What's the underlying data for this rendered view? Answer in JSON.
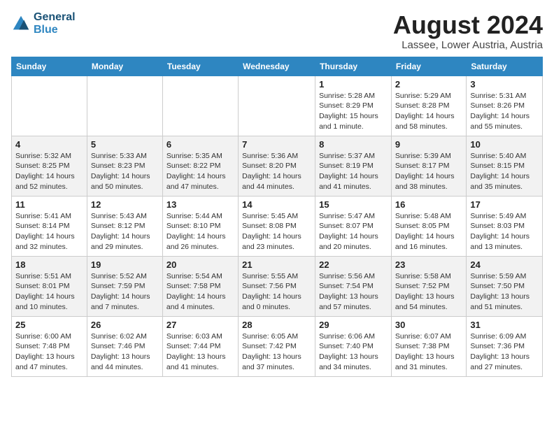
{
  "logo": {
    "line1": "General",
    "line2": "Blue"
  },
  "title": "August 2024",
  "location": "Lassee, Lower Austria, Austria",
  "days_header": [
    "Sunday",
    "Monday",
    "Tuesday",
    "Wednesday",
    "Thursday",
    "Friday",
    "Saturday"
  ],
  "weeks": [
    [
      {
        "day": "",
        "info": ""
      },
      {
        "day": "",
        "info": ""
      },
      {
        "day": "",
        "info": ""
      },
      {
        "day": "",
        "info": ""
      },
      {
        "day": "1",
        "info": "Sunrise: 5:28 AM\nSunset: 8:29 PM\nDaylight: 15 hours\nand 1 minute."
      },
      {
        "day": "2",
        "info": "Sunrise: 5:29 AM\nSunset: 8:28 PM\nDaylight: 14 hours\nand 58 minutes."
      },
      {
        "day": "3",
        "info": "Sunrise: 5:31 AM\nSunset: 8:26 PM\nDaylight: 14 hours\nand 55 minutes."
      }
    ],
    [
      {
        "day": "4",
        "info": "Sunrise: 5:32 AM\nSunset: 8:25 PM\nDaylight: 14 hours\nand 52 minutes."
      },
      {
        "day": "5",
        "info": "Sunrise: 5:33 AM\nSunset: 8:23 PM\nDaylight: 14 hours\nand 50 minutes."
      },
      {
        "day": "6",
        "info": "Sunrise: 5:35 AM\nSunset: 8:22 PM\nDaylight: 14 hours\nand 47 minutes."
      },
      {
        "day": "7",
        "info": "Sunrise: 5:36 AM\nSunset: 8:20 PM\nDaylight: 14 hours\nand 44 minutes."
      },
      {
        "day": "8",
        "info": "Sunrise: 5:37 AM\nSunset: 8:19 PM\nDaylight: 14 hours\nand 41 minutes."
      },
      {
        "day": "9",
        "info": "Sunrise: 5:39 AM\nSunset: 8:17 PM\nDaylight: 14 hours\nand 38 minutes."
      },
      {
        "day": "10",
        "info": "Sunrise: 5:40 AM\nSunset: 8:15 PM\nDaylight: 14 hours\nand 35 minutes."
      }
    ],
    [
      {
        "day": "11",
        "info": "Sunrise: 5:41 AM\nSunset: 8:14 PM\nDaylight: 14 hours\nand 32 minutes."
      },
      {
        "day": "12",
        "info": "Sunrise: 5:43 AM\nSunset: 8:12 PM\nDaylight: 14 hours\nand 29 minutes."
      },
      {
        "day": "13",
        "info": "Sunrise: 5:44 AM\nSunset: 8:10 PM\nDaylight: 14 hours\nand 26 minutes."
      },
      {
        "day": "14",
        "info": "Sunrise: 5:45 AM\nSunset: 8:08 PM\nDaylight: 14 hours\nand 23 minutes."
      },
      {
        "day": "15",
        "info": "Sunrise: 5:47 AM\nSunset: 8:07 PM\nDaylight: 14 hours\nand 20 minutes."
      },
      {
        "day": "16",
        "info": "Sunrise: 5:48 AM\nSunset: 8:05 PM\nDaylight: 14 hours\nand 16 minutes."
      },
      {
        "day": "17",
        "info": "Sunrise: 5:49 AM\nSunset: 8:03 PM\nDaylight: 14 hours\nand 13 minutes."
      }
    ],
    [
      {
        "day": "18",
        "info": "Sunrise: 5:51 AM\nSunset: 8:01 PM\nDaylight: 14 hours\nand 10 minutes."
      },
      {
        "day": "19",
        "info": "Sunrise: 5:52 AM\nSunset: 7:59 PM\nDaylight: 14 hours\nand 7 minutes."
      },
      {
        "day": "20",
        "info": "Sunrise: 5:54 AM\nSunset: 7:58 PM\nDaylight: 14 hours\nand 4 minutes."
      },
      {
        "day": "21",
        "info": "Sunrise: 5:55 AM\nSunset: 7:56 PM\nDaylight: 14 hours\nand 0 minutes."
      },
      {
        "day": "22",
        "info": "Sunrise: 5:56 AM\nSunset: 7:54 PM\nDaylight: 13 hours\nand 57 minutes."
      },
      {
        "day": "23",
        "info": "Sunrise: 5:58 AM\nSunset: 7:52 PM\nDaylight: 13 hours\nand 54 minutes."
      },
      {
        "day": "24",
        "info": "Sunrise: 5:59 AM\nSunset: 7:50 PM\nDaylight: 13 hours\nand 51 minutes."
      }
    ],
    [
      {
        "day": "25",
        "info": "Sunrise: 6:00 AM\nSunset: 7:48 PM\nDaylight: 13 hours\nand 47 minutes."
      },
      {
        "day": "26",
        "info": "Sunrise: 6:02 AM\nSunset: 7:46 PM\nDaylight: 13 hours\nand 44 minutes."
      },
      {
        "day": "27",
        "info": "Sunrise: 6:03 AM\nSunset: 7:44 PM\nDaylight: 13 hours\nand 41 minutes."
      },
      {
        "day": "28",
        "info": "Sunrise: 6:05 AM\nSunset: 7:42 PM\nDaylight: 13 hours\nand 37 minutes."
      },
      {
        "day": "29",
        "info": "Sunrise: 6:06 AM\nSunset: 7:40 PM\nDaylight: 13 hours\nand 34 minutes."
      },
      {
        "day": "30",
        "info": "Sunrise: 6:07 AM\nSunset: 7:38 PM\nDaylight: 13 hours\nand 31 minutes."
      },
      {
        "day": "31",
        "info": "Sunrise: 6:09 AM\nSunset: 7:36 PM\nDaylight: 13 hours\nand 27 minutes."
      }
    ]
  ]
}
